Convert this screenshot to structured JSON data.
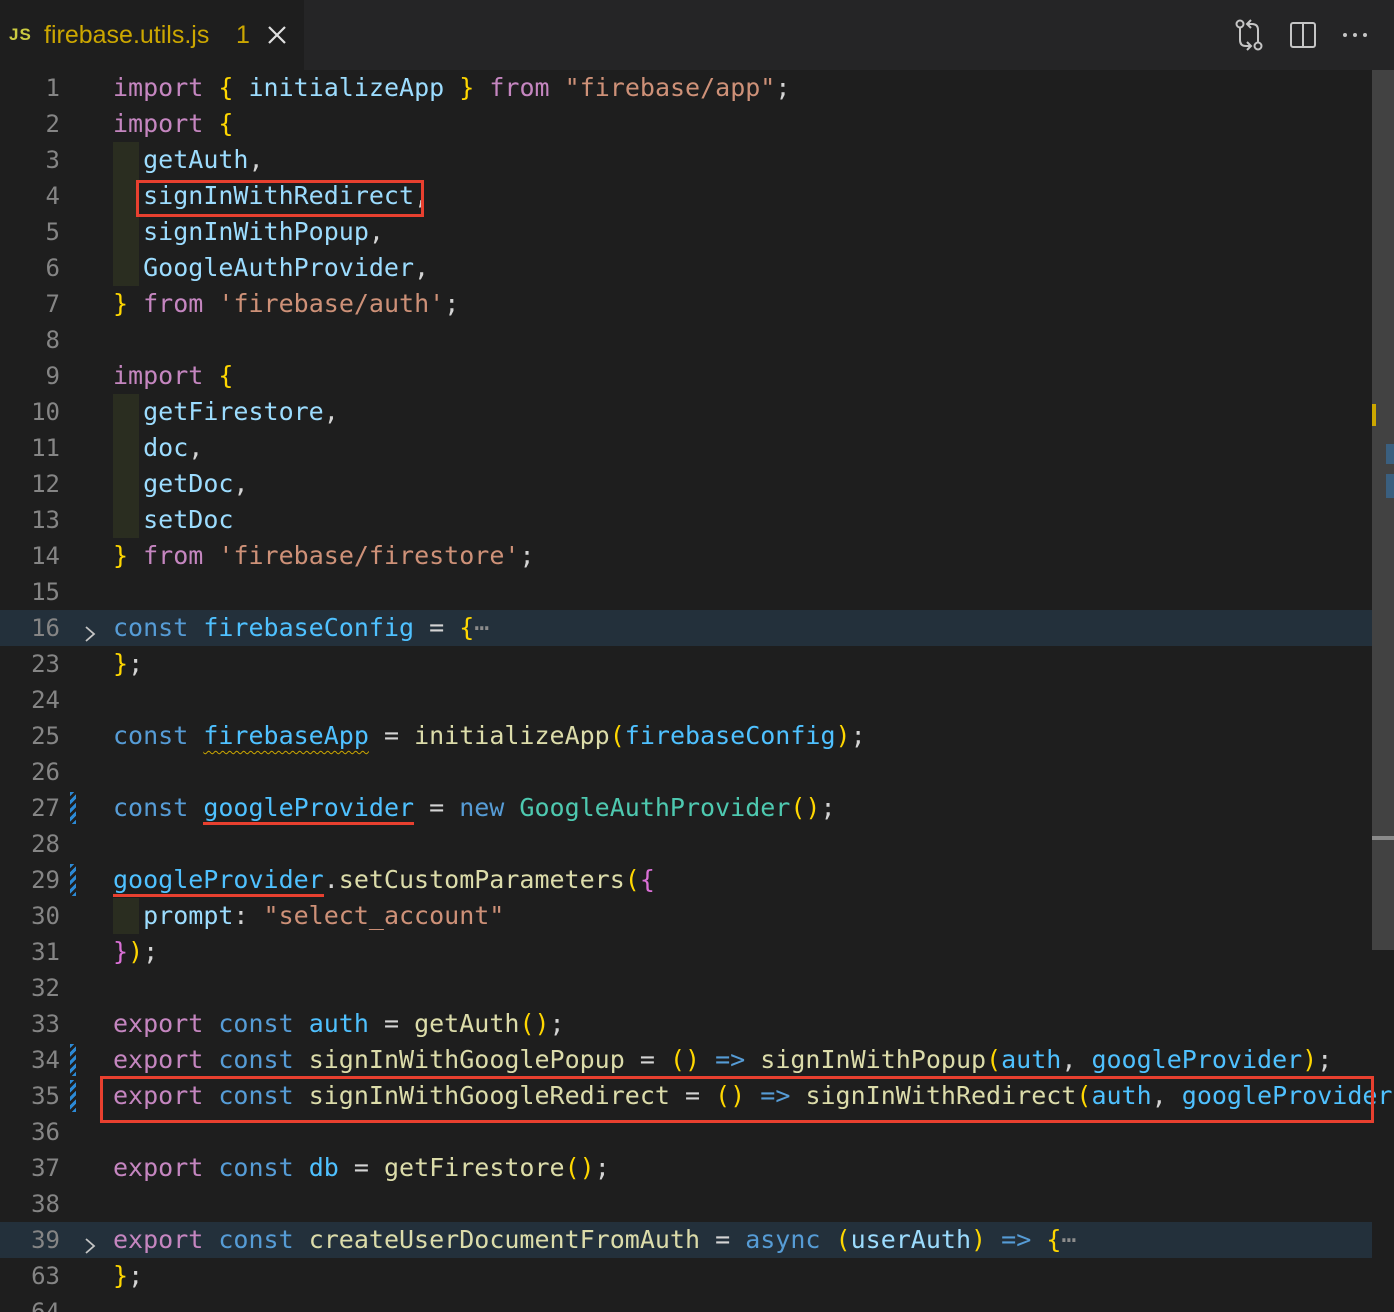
{
  "tab": {
    "badge": "JS",
    "title": "firebase.utils.js",
    "problem_count": "1"
  },
  "icons": {
    "close": "close-icon",
    "compare_changes": "git-compare-icon",
    "split_editor": "split-editor-icon",
    "more_actions": "ellipsis-icon",
    "fold": "chevron-right-icon"
  },
  "colors": {
    "keyword": "#c586c0",
    "storage": "#569cd6",
    "variable": "#9cdcfe",
    "function": "#dcdcaa",
    "type": "#4ec9b0",
    "string": "#ce9178",
    "annotation_red": "#e8402f",
    "warning": "#cca700"
  },
  "lines": [
    {
      "n": "1",
      "tokens": [
        [
          "kw",
          "import"
        ],
        [
          "pn",
          " "
        ],
        [
          "br1",
          "{"
        ],
        [
          "pn",
          " "
        ],
        [
          "vr",
          "initializeApp"
        ],
        [
          "pn",
          " "
        ],
        [
          "br1",
          "}"
        ],
        [
          "pn",
          " "
        ],
        [
          "kw",
          "from"
        ],
        [
          "pn",
          " "
        ],
        [
          "str",
          "\"firebase/app\""
        ],
        [
          "pn",
          ";"
        ]
      ]
    },
    {
      "n": "2",
      "tokens": [
        [
          "kw",
          "import"
        ],
        [
          "pn",
          " "
        ],
        [
          "br1",
          "{"
        ]
      ]
    },
    {
      "n": "3",
      "tokens": [
        [
          "pn",
          "  "
        ],
        [
          "vr",
          "getAuth"
        ],
        [
          "pn",
          ","
        ]
      ]
    },
    {
      "n": "4",
      "tokens": [
        [
          "pn",
          "  "
        ],
        [
          "vr",
          "signInWithRedirect"
        ],
        [
          "pn",
          ","
        ]
      ]
    },
    {
      "n": "5",
      "tokens": [
        [
          "pn",
          "  "
        ],
        [
          "vr",
          "signInWithPopup"
        ],
        [
          "pn",
          ","
        ]
      ]
    },
    {
      "n": "6",
      "tokens": [
        [
          "pn",
          "  "
        ],
        [
          "vr",
          "GoogleAuthProvider"
        ],
        [
          "pn",
          ","
        ]
      ]
    },
    {
      "n": "7",
      "tokens": [
        [
          "br1",
          "}"
        ],
        [
          "pn",
          " "
        ],
        [
          "kw",
          "from"
        ],
        [
          "pn",
          " "
        ],
        [
          "str",
          "'firebase/auth'"
        ],
        [
          "pn",
          ";"
        ]
      ]
    },
    {
      "n": "8",
      "tokens": []
    },
    {
      "n": "9",
      "tokens": [
        [
          "kw",
          "import"
        ],
        [
          "pn",
          " "
        ],
        [
          "br1",
          "{"
        ]
      ]
    },
    {
      "n": "10",
      "tokens": [
        [
          "pn",
          "  "
        ],
        [
          "vr",
          "getFirestore"
        ],
        [
          "pn",
          ","
        ]
      ]
    },
    {
      "n": "11",
      "tokens": [
        [
          "pn",
          "  "
        ],
        [
          "vr",
          "doc"
        ],
        [
          "pn",
          ","
        ]
      ]
    },
    {
      "n": "12",
      "tokens": [
        [
          "pn",
          "  "
        ],
        [
          "vr",
          "getDoc"
        ],
        [
          "pn",
          ","
        ]
      ]
    },
    {
      "n": "13",
      "tokens": [
        [
          "pn",
          "  "
        ],
        [
          "vr",
          "setDoc"
        ]
      ]
    },
    {
      "n": "14",
      "tokens": [
        [
          "br1",
          "}"
        ],
        [
          "pn",
          " "
        ],
        [
          "kw",
          "from"
        ],
        [
          "pn",
          " "
        ],
        [
          "str",
          "'firebase/firestore'"
        ],
        [
          "pn",
          ";"
        ]
      ]
    },
    {
      "n": "15",
      "tokens": []
    },
    {
      "n": "16",
      "tokens": [
        [
          "st",
          "const"
        ],
        [
          "pn",
          " "
        ],
        [
          "vc",
          "firebaseConfig"
        ],
        [
          "pn",
          " = "
        ],
        [
          "br1",
          "{"
        ],
        [
          "ellip",
          "⋯"
        ]
      ]
    },
    {
      "n": "23",
      "tokens": [
        [
          "br1",
          "}"
        ],
        [
          "pn",
          ";"
        ]
      ]
    },
    {
      "n": "24",
      "tokens": []
    },
    {
      "n": "25",
      "tokens": [
        [
          "st",
          "const"
        ],
        [
          "pn",
          " "
        ],
        [
          "vc squiggle",
          "firebaseApp"
        ],
        [
          "pn",
          " = "
        ],
        [
          "fn",
          "initializeApp"
        ],
        [
          "br1",
          "("
        ],
        [
          "vc",
          "firebaseConfig"
        ],
        [
          "br1",
          ")"
        ],
        [
          "pn",
          ";"
        ]
      ]
    },
    {
      "n": "26",
      "tokens": []
    },
    {
      "n": "27",
      "tokens": [
        [
          "st",
          "const"
        ],
        [
          "pn",
          " "
        ],
        [
          "vc red-underline",
          "googleProvider"
        ],
        [
          "pn",
          " = "
        ],
        [
          "st",
          "new"
        ],
        [
          "pn",
          " "
        ],
        [
          "ty",
          "GoogleAuthProvider"
        ],
        [
          "br1",
          "()"
        ],
        [
          "pn",
          ";"
        ]
      ]
    },
    {
      "n": "28",
      "tokens": []
    },
    {
      "n": "29",
      "tokens": [
        [
          "vc red-underline",
          "googleProvider"
        ],
        [
          "pn",
          "."
        ],
        [
          "fn",
          "setCustomParameters"
        ],
        [
          "br1",
          "("
        ],
        [
          "br2",
          "{"
        ]
      ]
    },
    {
      "n": "30",
      "tokens": [
        [
          "pn",
          "  "
        ],
        [
          "vr",
          "prompt"
        ],
        [
          "pn",
          ": "
        ],
        [
          "str",
          "\"select_account\""
        ]
      ]
    },
    {
      "n": "31",
      "tokens": [
        [
          "br2",
          "}"
        ],
        [
          "br1",
          ")"
        ],
        [
          "pn",
          ";"
        ]
      ]
    },
    {
      "n": "32",
      "tokens": []
    },
    {
      "n": "33",
      "tokens": [
        [
          "kw",
          "export"
        ],
        [
          "pn",
          " "
        ],
        [
          "st",
          "const"
        ],
        [
          "pn",
          " "
        ],
        [
          "vc",
          "auth"
        ],
        [
          "pn",
          " = "
        ],
        [
          "fn",
          "getAuth"
        ],
        [
          "br1",
          "()"
        ],
        [
          "pn",
          ";"
        ]
      ]
    },
    {
      "n": "34",
      "tokens": [
        [
          "kw",
          "export"
        ],
        [
          "pn",
          " "
        ],
        [
          "st",
          "const"
        ],
        [
          "pn",
          " "
        ],
        [
          "fn",
          "signInWithGooglePopup"
        ],
        [
          "pn",
          " = "
        ],
        [
          "br1",
          "()"
        ],
        [
          "pn",
          " "
        ],
        [
          "st",
          "=>"
        ],
        [
          "pn",
          " "
        ],
        [
          "fn",
          "signInWithPopup"
        ],
        [
          "br1",
          "("
        ],
        [
          "vc",
          "auth"
        ],
        [
          "pn",
          ", "
        ],
        [
          "vc",
          "googleProvider"
        ],
        [
          "br1",
          ")"
        ],
        [
          "pn",
          ";"
        ]
      ]
    },
    {
      "n": "35",
      "tokens": [
        [
          "kw",
          "export"
        ],
        [
          "pn",
          " "
        ],
        [
          "st",
          "const"
        ],
        [
          "pn",
          " "
        ],
        [
          "fn",
          "signInWithGoogleRedirect"
        ],
        [
          "pn",
          " = "
        ],
        [
          "br1",
          "()"
        ],
        [
          "pn",
          " "
        ],
        [
          "st",
          "=>"
        ],
        [
          "pn",
          " "
        ],
        [
          "fn",
          "signInWithRedirect"
        ],
        [
          "br1",
          "("
        ],
        [
          "vc",
          "auth"
        ],
        [
          "pn",
          ", "
        ],
        [
          "vc",
          "googleProvider"
        ],
        [
          "br1",
          ")"
        ],
        [
          "pn",
          ";"
        ]
      ]
    },
    {
      "n": "36",
      "tokens": []
    },
    {
      "n": "37",
      "tokens": [
        [
          "kw",
          "export"
        ],
        [
          "pn",
          " "
        ],
        [
          "st",
          "const"
        ],
        [
          "pn",
          " "
        ],
        [
          "vc",
          "db"
        ],
        [
          "pn",
          " = "
        ],
        [
          "fn",
          "getFirestore"
        ],
        [
          "br1",
          "()"
        ],
        [
          "pn",
          ";"
        ]
      ]
    },
    {
      "n": "38",
      "tokens": []
    },
    {
      "n": "39",
      "tokens": [
        [
          "kw",
          "export"
        ],
        [
          "pn",
          " "
        ],
        [
          "st",
          "const"
        ],
        [
          "pn",
          " "
        ],
        [
          "fn",
          "createUserDocumentFromAuth"
        ],
        [
          "pn",
          " = "
        ],
        [
          "st",
          "async"
        ],
        [
          "pn",
          " "
        ],
        [
          "br1",
          "("
        ],
        [
          "vr",
          "userAuth"
        ],
        [
          "br1",
          ")"
        ],
        [
          "pn",
          " "
        ],
        [
          "st",
          "=>"
        ],
        [
          "pn",
          " "
        ],
        [
          "br1",
          "{"
        ],
        [
          "ellip",
          "⋯"
        ]
      ]
    },
    {
      "n": "63",
      "tokens": [
        [
          "br1",
          "}"
        ],
        [
          "pn",
          ";"
        ]
      ]
    },
    {
      "n": "64",
      "tokens": []
    }
  ]
}
